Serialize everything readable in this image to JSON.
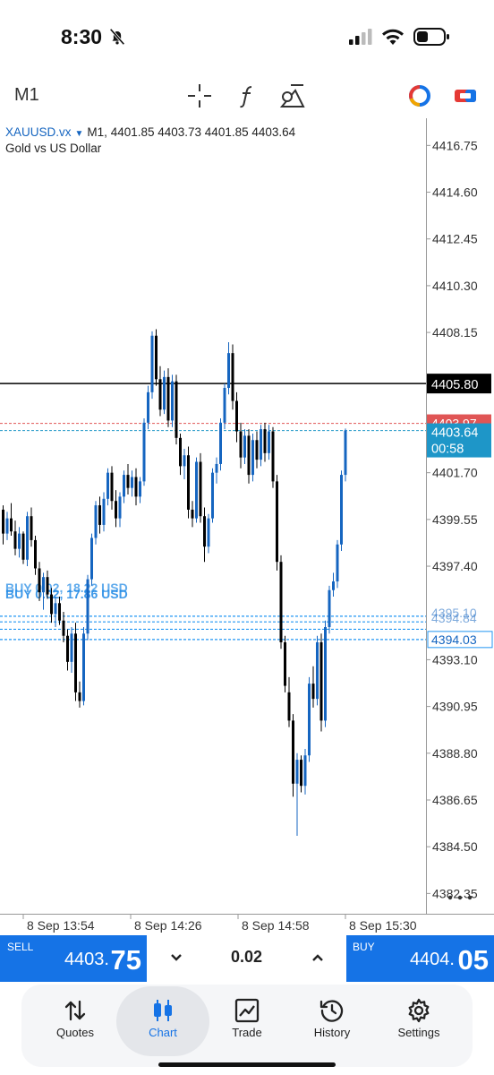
{
  "status_bar": {
    "time": "8:30"
  },
  "toolbar": {
    "timeframe": "M1"
  },
  "chart": {
    "symbol": "XAUUSD.vx",
    "timeframe": "M1,",
    "ohlc": "4401.85 4403.73 4401.85 4403.64",
    "description": "Gold vs US Dollar"
  },
  "chart_data": {
    "type": "candlestick",
    "price_axis_labels": [
      "4416.75",
      "4414.60",
      "4412.45",
      "4410.30",
      "4408.15",
      "4401.70",
      "4399.55",
      "4397.40",
      "4393.10",
      "4390.95",
      "4388.80",
      "4386.65",
      "4384.50",
      "4382.35"
    ],
    "time_axis_labels": [
      "8 Sep 13:54",
      "8 Sep 14:26",
      "8 Sep 14:58",
      "8 Sep 15:30"
    ],
    "ylim": [
      4381.5,
      4418.0
    ],
    "horizontal_lines": [
      {
        "label": "4405.80",
        "price": 4405.8,
        "color": "#000000",
        "style": "solid"
      },
      {
        "label": "4403.97",
        "price": 4403.97,
        "color": "#e05555",
        "style": "dashed"
      },
      {
        "label": "4403.64",
        "price": 4403.64,
        "color": "#1e96c8",
        "style": "dashed",
        "countdown": "00:58"
      }
    ],
    "position_lines": [
      {
        "price": 4395.1,
        "label": "4395.10"
      },
      {
        "price": 4394.84,
        "label": "4394.84"
      },
      {
        "price": 4394.03,
        "label": "4394.03"
      },
      {
        "price": 4394.5,
        "label": "4394.50"
      }
    ],
    "position_texts": [
      "BUY 0.02, 17.86 USD",
      "BUY 0.02, 18.22 USD"
    ],
    "candles": [
      [
        4400.0,
        4400.2,
        4398.4,
        4398.9
      ],
      [
        4398.9,
        4399.9,
        4398.6,
        4399.6
      ],
      [
        4399.6,
        4400.3,
        4398.8,
        4399.0
      ],
      [
        4399.0,
        4399.5,
        4397.9,
        4398.2
      ],
      [
        4398.2,
        4399.2,
        4397.8,
        4398.9
      ],
      [
        4398.9,
        4399.0,
        4397.5,
        4397.7
      ],
      [
        4397.7,
        4399.9,
        4397.4,
        4399.7
      ],
      [
        4399.7,
        4400.1,
        4398.3,
        4398.6
      ],
      [
        4398.6,
        4398.8,
        4397.0,
        4397.3
      ],
      [
        4397.3,
        4397.6,
        4395.8,
        4396.2
      ],
      [
        4396.2,
        4397.1,
        4395.4,
        4396.9
      ],
      [
        4396.9,
        4397.2,
        4395.9,
        4396.1
      ],
      [
        4396.1,
        4396.4,
        4394.8,
        4395.2
      ],
      [
        4395.2,
        4396.0,
        4394.6,
        4395.7
      ],
      [
        4395.7,
        4396.0,
        4394.7,
        4394.9
      ],
      [
        4394.9,
        4395.3,
        4393.9,
        4394.2
      ],
      [
        4394.2,
        4394.5,
        4392.6,
        4393.0
      ],
      [
        4393.0,
        4394.6,
        4392.5,
        4394.3
      ],
      [
        4394.3,
        4394.8,
        4391.2,
        4391.6
      ],
      [
        4391.6,
        4392.1,
        4390.9,
        4391.2
      ],
      [
        4391.2,
        4394.6,
        4391.0,
        4394.3
      ],
      [
        4394.3,
        4397.0,
        4394.0,
        4396.8
      ],
      [
        4396.8,
        4398.9,
        4396.5,
        4398.7
      ],
      [
        4398.7,
        4400.4,
        4398.4,
        4400.2
      ],
      [
        4400.2,
        4400.6,
        4398.9,
        4399.3
      ],
      [
        4399.3,
        4400.8,
        4399.0,
        4400.5
      ],
      [
        4400.5,
        4401.9,
        4400.2,
        4401.7
      ],
      [
        4401.7,
        4402.0,
        4400.0,
        4400.4
      ],
      [
        4400.4,
        4400.9,
        4399.2,
        4399.6
      ],
      [
        4399.6,
        4400.8,
        4399.2,
        4400.6
      ],
      [
        4400.6,
        4401.8,
        4400.3,
        4401.6
      ],
      [
        4401.6,
        4402.1,
        4400.7,
        4401.0
      ],
      [
        4401.0,
        4401.8,
        4400.6,
        4401.5
      ],
      [
        4401.5,
        4401.9,
        4400.2,
        4400.6
      ],
      [
        4400.6,
        4401.5,
        4400.3,
        4401.3
      ],
      [
        4401.3,
        4404.2,
        4401.1,
        4404.0
      ],
      [
        4404.0,
        4405.7,
        4403.7,
        4405.4
      ],
      [
        4405.4,
        4408.2,
        4405.1,
        4408.0
      ],
      [
        4408.0,
        4408.3,
        4405.7,
        4406.0
      ],
      [
        4406.0,
        4406.6,
        4404.3,
        4404.6
      ],
      [
        4404.6,
        4406.4,
        4404.4,
        4406.1
      ],
      [
        4406.1,
        4406.5,
        4403.8,
        4404.1
      ],
      [
        4404.1,
        4406.2,
        4403.8,
        4405.9
      ],
      [
        4405.9,
        4406.2,
        4403.0,
        4403.3
      ],
      [
        4403.3,
        4403.5,
        4401.6,
        4402.0
      ],
      [
        4402.0,
        4402.8,
        4401.4,
        4402.5
      ],
      [
        4402.5,
        4402.9,
        4399.6,
        4400.0
      ],
      [
        4400.0,
        4400.4,
        4399.2,
        4399.6
      ],
      [
        4399.6,
        4402.4,
        4399.4,
        4402.2
      ],
      [
        4402.2,
        4402.6,
        4399.4,
        4399.7
      ],
      [
        4399.7,
        4400.1,
        4397.6,
        4398.3
      ],
      [
        4398.3,
        4399.8,
        4398.0,
        4399.6
      ],
      [
        4399.6,
        4401.9,
        4399.4,
        4401.7
      ],
      [
        4401.7,
        4402.4,
        4401.2,
        4402.1
      ],
      [
        4402.1,
        4404.2,
        4401.8,
        4404.0
      ],
      [
        4404.0,
        4405.8,
        4403.7,
        4405.6
      ],
      [
        4405.6,
        4407.7,
        4405.3,
        4407.2
      ],
      [
        4407.2,
        4407.6,
        4404.6,
        4405.0
      ],
      [
        4405.0,
        4405.4,
        4403.1,
        4403.6
      ],
      [
        4403.6,
        4404.0,
        4401.9,
        4402.4
      ],
      [
        4402.4,
        4403.7,
        4402.1,
        4403.4
      ],
      [
        4403.4,
        4403.7,
        4401.2,
        4401.6
      ],
      [
        4401.6,
        4403.5,
        4401.3,
        4403.2
      ],
      [
        4403.2,
        4403.6,
        4401.9,
        4402.3
      ],
      [
        4402.3,
        4403.9,
        4402.0,
        4403.7
      ],
      [
        4403.7,
        4404.0,
        4402.2,
        4402.6
      ],
      [
        4402.6,
        4403.9,
        4402.3,
        4403.6
      ],
      [
        4403.6,
        4403.8,
        4401.0,
        4401.3
      ],
      [
        4401.3,
        4401.6,
        4397.2,
        4397.6
      ],
      [
        4397.6,
        4397.9,
        4393.6,
        4393.9
      ],
      [
        4393.9,
        4394.2,
        4391.6,
        4391.9
      ],
      [
        4391.6,
        4392.3,
        4390.0,
        4390.3
      ],
      [
        4390.3,
        4390.6,
        4386.8,
        4387.4
      ],
      [
        4387.4,
        4388.8,
        4385.0,
        4388.5
      ],
      [
        4388.5,
        4388.7,
        4387.0,
        4387.3
      ],
      [
        4387.3,
        4389.0,
        4386.9,
        4388.7
      ],
      [
        4388.7,
        4392.3,
        4388.4,
        4392.0
      ],
      [
        4392.0,
        4392.8,
        4390.9,
        4391.3
      ],
      [
        4391.3,
        4394.2,
        4391.0,
        4393.9
      ],
      [
        4393.9,
        4394.3,
        4389.8,
        4390.3
      ],
      [
        4390.3,
        4394.9,
        4390.0,
        4394.6
      ],
      [
        4394.6,
        4396.5,
        4394.3,
        4396.3
      ],
      [
        4396.3,
        4397.1,
        4396.0,
        4396.7
      ],
      [
        4396.7,
        4398.6,
        4396.4,
        4398.4
      ],
      [
        4398.4,
        4401.8,
        4398.1,
        4401.6
      ],
      [
        4401.6,
        4403.73,
        4401.3,
        4403.64
      ]
    ]
  },
  "trade_bar": {
    "sell_label": "SELL",
    "sell_price_small": "4403.",
    "sell_price_big": "75",
    "lot": "0.02",
    "buy_label": "BUY",
    "buy_price_small": "4404.",
    "buy_price_big": "05"
  },
  "nav": {
    "quotes": "Quotes",
    "chart": "Chart",
    "trade": "Trade",
    "history": "History",
    "settings": "Settings"
  },
  "colors": {
    "accent": "#1573e6",
    "bull": "#1565c0",
    "bear": "#000000"
  }
}
